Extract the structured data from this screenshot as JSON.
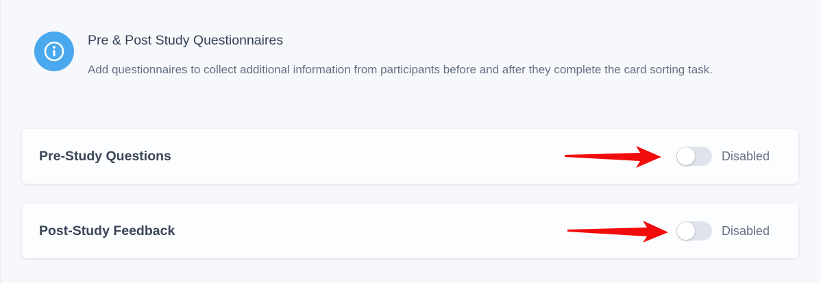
{
  "info": {
    "icon": "info-icon",
    "title": "Pre & Post Study Questionnaires",
    "description": "Add questionnaires to collect additional information from participants before and after they complete the card sorting task."
  },
  "settings": [
    {
      "label": "Pre-Study Questions",
      "enabled": false,
      "status_label": "Disabled"
    },
    {
      "label": "Post-Study Feedback",
      "enabled": false,
      "status_label": "Disabled"
    }
  ],
  "colors": {
    "accent": "#4aa8ee",
    "annotation_arrow": "#f20d0d",
    "toggle_off": "#dfe4ec"
  }
}
